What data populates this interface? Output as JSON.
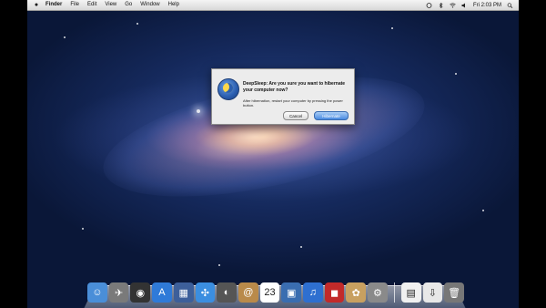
{
  "menubar": {
    "app_name": "Finder",
    "items": [
      "File",
      "Edit",
      "View",
      "Go",
      "Window",
      "Help"
    ],
    "clock": "Fri 2:03 PM"
  },
  "dialog": {
    "title": "DeepSleep: Are you sure you want to hibernate your computer now?",
    "message": "After hibernation, restart your computer by pressing the power button.",
    "cancel_label": "Cancel",
    "confirm_label": "Hibernate"
  },
  "dock": {
    "items": [
      {
        "name": "finder",
        "glyph": "☺",
        "color": "#4a8ed8"
      },
      {
        "name": "launchpad",
        "glyph": "✈",
        "color": "#7a7a7a"
      },
      {
        "name": "dashboard",
        "glyph": "◉",
        "color": "#333333"
      },
      {
        "name": "app-store",
        "glyph": "A",
        "color": "#2f7ad8"
      },
      {
        "name": "mission-control",
        "glyph": "▦",
        "color": "#3d5f9a"
      },
      {
        "name": "safari",
        "glyph": "✣",
        "color": "#3b8ee0"
      },
      {
        "name": "facetime",
        "glyph": "◐",
        "color": "#555555"
      },
      {
        "name": "address-book",
        "glyph": "@",
        "color": "#b98a4a"
      },
      {
        "name": "calendar",
        "glyph": "23",
        "color": "#ffffff"
      },
      {
        "name": "preview",
        "glyph": "▣",
        "color": "#3a6db0"
      },
      {
        "name": "itunes",
        "glyph": "♫",
        "color": "#2e6fd0"
      },
      {
        "name": "photo-booth",
        "glyph": "◼",
        "color": "#c22a2a"
      },
      {
        "name": "iphoto",
        "glyph": "✿",
        "color": "#c8a060"
      },
      {
        "name": "system-preferences",
        "glyph": "⚙",
        "color": "#8a8a8a"
      },
      {
        "name": "documents",
        "glyph": "▤",
        "color": "#f0f0f0"
      },
      {
        "name": "downloads",
        "glyph": "⇩",
        "color": "#e8e8e8"
      },
      {
        "name": "trash",
        "glyph": "🗑",
        "color": "#777777"
      }
    ]
  }
}
